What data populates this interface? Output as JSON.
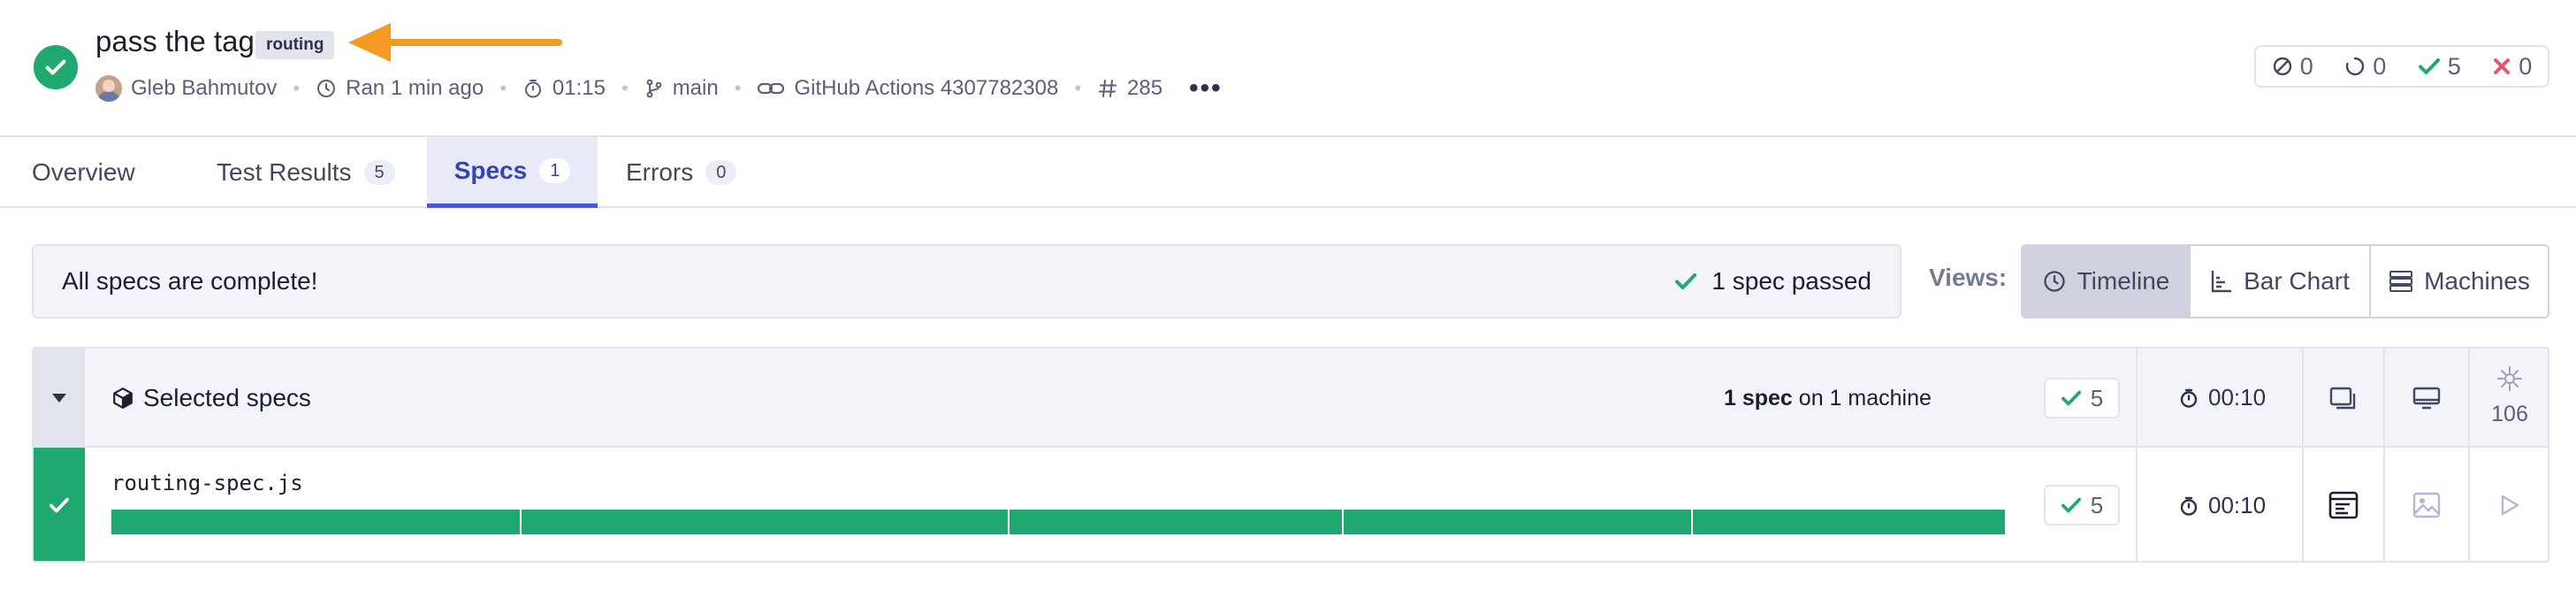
{
  "header": {
    "title": "pass the tag",
    "tag": "routing",
    "author": "Gleb Bahmutov",
    "ran": "Ran 1 min ago",
    "duration": "01:15",
    "branch": "main",
    "ci": "GitHub Actions 4307782308",
    "run_number": "285",
    "more_label": "•••"
  },
  "counts": {
    "skipped": "0",
    "pending": "0",
    "passed": "5",
    "failed": "0"
  },
  "tabs": [
    {
      "label": "Overview"
    },
    {
      "label": "Test Results",
      "badge": "5"
    },
    {
      "label": "Specs",
      "badge": "1"
    },
    {
      "label": "Errors",
      "badge": "0"
    }
  ],
  "banner": {
    "message": "All specs are complete!",
    "summary": "1 spec passed"
  },
  "views": {
    "label": "Views:",
    "options": [
      "Timeline",
      "Bar Chart",
      "Machines"
    ],
    "selected": "Timeline"
  },
  "group": {
    "label": "Selected specs",
    "spec_count": "1 spec",
    "machine_text": "on 1 machine",
    "passed": "5",
    "duration": "00:10",
    "flaky_count": "106"
  },
  "spec": {
    "name": "routing-spec.js",
    "passed": "5",
    "duration": "00:10"
  },
  "colors": {
    "success": "#1fa971",
    "failure": "#e45770",
    "accent": "#4956e3",
    "annotation": "#f59a23"
  },
  "icons": {
    "status": "check-circle-icon",
    "skipped": "slash-circle-icon",
    "pending": "refresh-icon",
    "passed": "check-icon",
    "failed": "x-icon"
  }
}
